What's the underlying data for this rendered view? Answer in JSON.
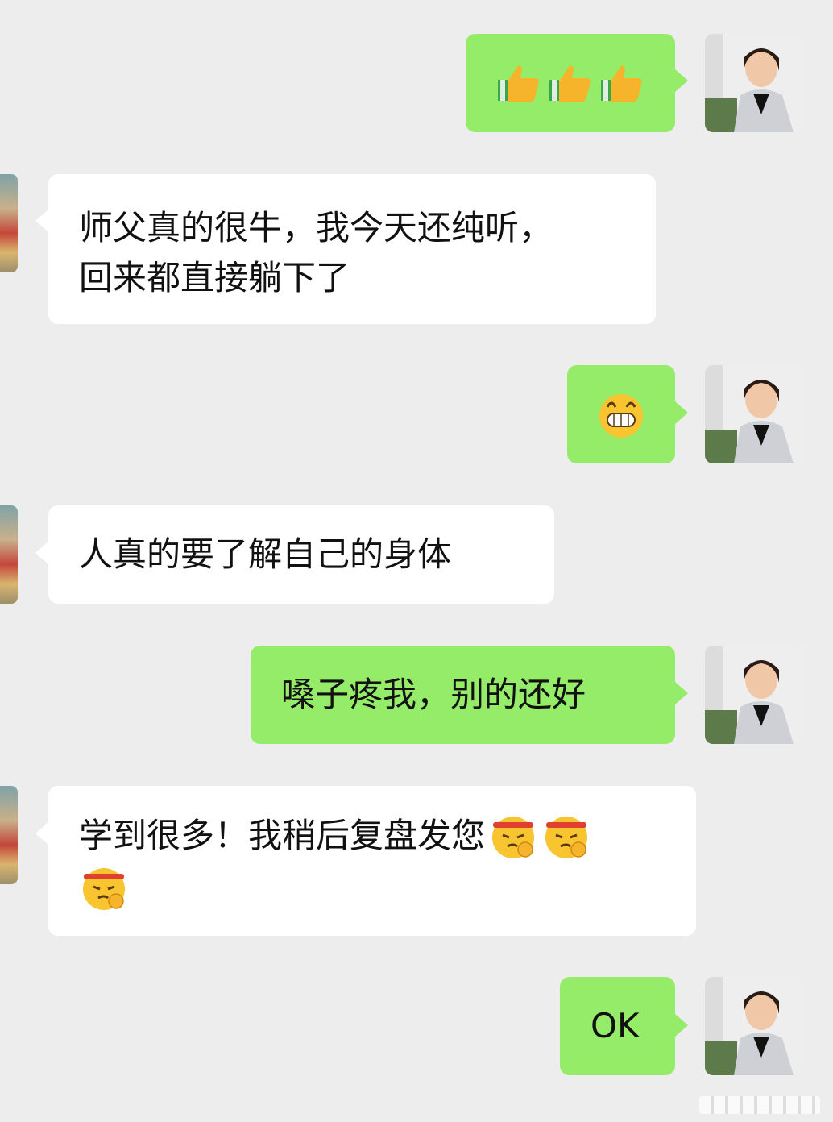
{
  "chat": {
    "messages": [
      {
        "side": "out",
        "kind": "emoji",
        "emoji": [
          "thumbs-up-icon",
          "thumbs-up-icon",
          "thumbs-up-icon"
        ]
      },
      {
        "side": "in",
        "kind": "text",
        "lines": [
          "师父真的很牛，我今天还纯听，",
          "回来都直接躺下了"
        ]
      },
      {
        "side": "out",
        "kind": "emoji",
        "emoji": [
          "grin-face-icon"
        ]
      },
      {
        "side": "in",
        "kind": "text",
        "lines": [
          "人真的要了解自己的身体"
        ]
      },
      {
        "side": "out",
        "kind": "text",
        "lines": [
          "嗓子疼我，别的还好"
        ]
      },
      {
        "side": "in",
        "kind": "text",
        "lines": [
          "学到很多！我稍后复盘发您",
          ""
        ],
        "emoji": [
          "determined-face-icon",
          "determined-face-icon",
          "determined-face-icon"
        ]
      },
      {
        "side": "out",
        "kind": "text",
        "lines": [
          "OK"
        ]
      }
    ]
  },
  "colors": {
    "background": "#ededed",
    "outgoing_bubble": "#95ec69",
    "incoming_bubble": "#ffffff"
  }
}
